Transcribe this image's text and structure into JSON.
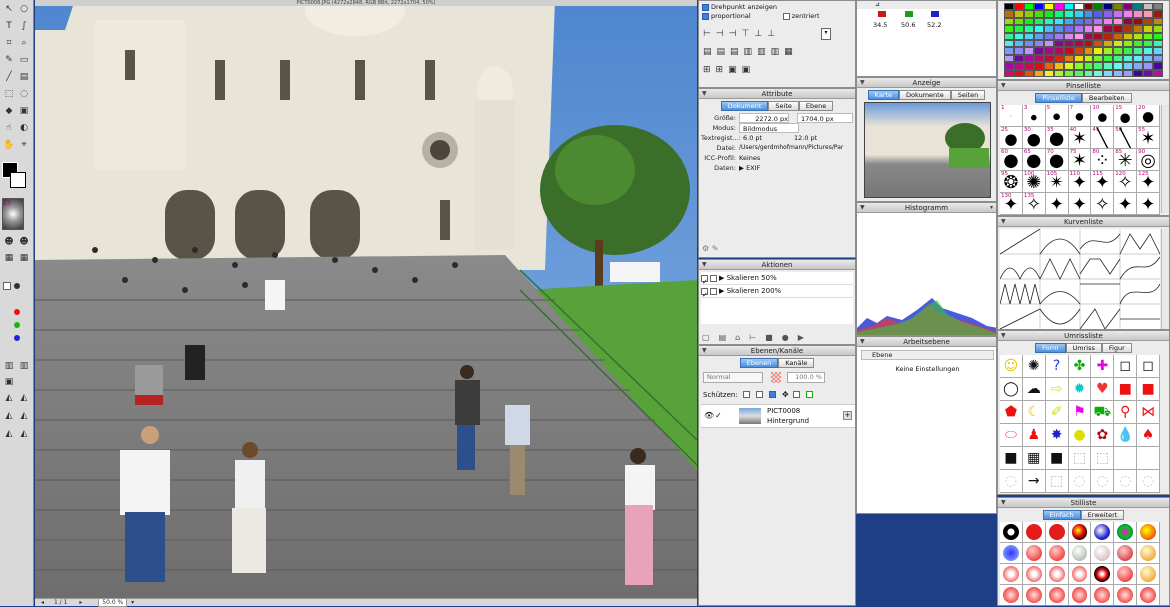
{
  "window": {
    "title": "PICT0008.JPG (4272x2848, RGB 8Bit, 2272x1704, 50%)"
  },
  "status": {
    "page": "1 / 1",
    "zoom": "50.0 %"
  },
  "transform": {
    "show_pivot": "Drehpunkt anzeigen",
    "proportional": "proportional",
    "centered": "zentriert",
    "color_values": [
      "34.5",
      "50.6",
      "52.2"
    ]
  },
  "attribute": {
    "title": "Attribute",
    "tabs": [
      "Dokument",
      "Seite",
      "Ebene"
    ],
    "active_tab": "Dokument",
    "size_label": "Größe:",
    "width": "2272.0 px",
    "height": "1704.0 px",
    "mode_label": "Modus:",
    "mode_value": "Bildmodus",
    "text_label": "Textregist...:",
    "text_a": "6.0 pt",
    "text_b": "12.0 pt",
    "file_label": "Datei:",
    "file_value": "/Users/gerdmhofmann/Pictures/Par",
    "icc_label": "ICC-Profil:",
    "icc_value": "Keines",
    "data_label": "Daten:",
    "data_value": "EXIF"
  },
  "actions": {
    "title": "Aktionen",
    "items": [
      "Skalieren 50%",
      "Skalieren 200%"
    ]
  },
  "layers": {
    "title": "Ebenen/Kanäle",
    "tabs": [
      "Ebenen",
      "Kanäle"
    ],
    "blend_mode": "Normal",
    "opacity": "100.0 %",
    "protect_label": "Schützen:",
    "layer_name": "PICT0008",
    "layer_sub": "Hintergrund"
  },
  "anzeige": {
    "title": "Anzeige",
    "tabs": [
      "Karte",
      "Dokumente",
      "Seiten"
    ]
  },
  "histogramm": {
    "title": "Histogramm"
  },
  "arbeitsebene": {
    "title": "Arbeitsebene",
    "field": "Ebene",
    "empty": "Keine Einstellungen"
  },
  "pinselliste": {
    "title": "Pinselliste",
    "tabs": [
      "Pinselliste",
      "Bearbeiten"
    ],
    "numbers": [
      "1",
      "3",
      "5",
      "7",
      "10",
      "15",
      "20",
      "25",
      "30",
      "35",
      "40",
      "45",
      "50",
      "55",
      "60",
      "65",
      "70",
      "75",
      "80",
      "85",
      "90",
      "95",
      "100",
      "105",
      "110",
      "115",
      "120",
      "125",
      "130",
      "135"
    ]
  },
  "kurvenliste": {
    "title": "Kurvenliste"
  },
  "umrissliste": {
    "title": "Umrissliste",
    "tabs": [
      "Form",
      "Umriss",
      "Figur"
    ]
  },
  "stilliste": {
    "title": "Stilliste",
    "tabs": [
      "Einfach",
      "Erweitert"
    ]
  },
  "colors": {
    "accent": "#3d7ee0",
    "desktop": "#1e3f86"
  }
}
